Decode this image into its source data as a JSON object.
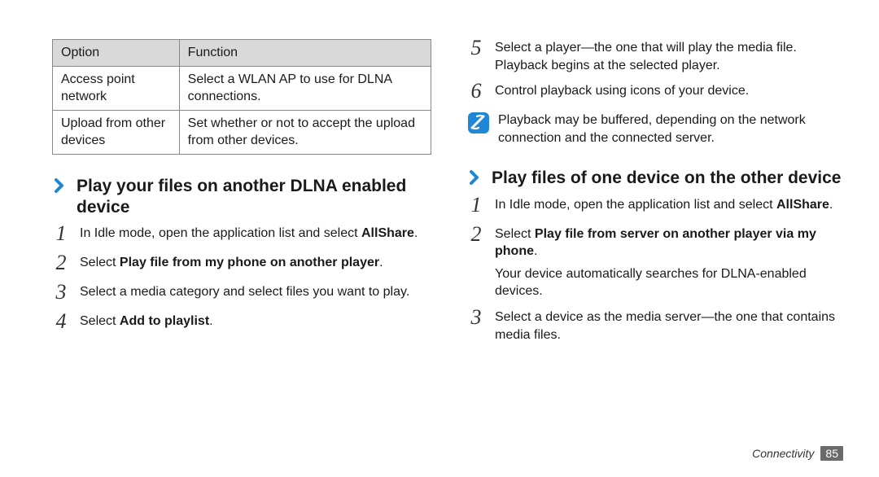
{
  "table": {
    "headers": {
      "option": "Option",
      "function": "Function"
    },
    "rows": [
      {
        "option": "Access point network",
        "function": "Select a WLAN AP to use for DLNA connections."
      },
      {
        "option": "Upload from other devices",
        "function": "Set whether or not to accept the upload from other devices."
      }
    ]
  },
  "section1": {
    "heading": "Play your files on another DLNA enabled device",
    "steps": [
      {
        "num": "1",
        "pre": "In Idle mode, open the application list and select ",
        "bold": "AllShare",
        "post": "."
      },
      {
        "num": "2",
        "pre": "Select ",
        "bold": "Play file from my phone on another player",
        "post": "."
      },
      {
        "num": "3",
        "pre": "Select a media category and select files you want to play.",
        "bold": "",
        "post": ""
      },
      {
        "num": "4",
        "pre": "Select ",
        "bold": "Add to playlist",
        "post": "."
      }
    ]
  },
  "col2_top_steps": [
    {
      "num": "5",
      "pre": "Select a player—the one that will play the media file. Playback begins at the selected player.",
      "bold": "",
      "post": ""
    },
    {
      "num": "6",
      "pre": "Control playback using icons of your device.",
      "bold": "",
      "post": ""
    }
  ],
  "note": "Playback may be buffered, depending on the network connection and the connected server.",
  "section2": {
    "heading": "Play files of one device on the other device",
    "steps": [
      {
        "num": "1",
        "pre": "In Idle mode, open the application list and select ",
        "bold": "AllShare",
        "post": "."
      },
      {
        "num": "2",
        "pre": "Select ",
        "bold": "Play file from server on another player via my phone",
        "post": ".",
        "after": "Your device automatically searches for DLNA-enabled devices."
      },
      {
        "num": "3",
        "pre": "Select a device as the media server—the one that contains media files.",
        "bold": "",
        "post": ""
      }
    ]
  },
  "footer": {
    "section": "Connectivity",
    "page": "85"
  }
}
